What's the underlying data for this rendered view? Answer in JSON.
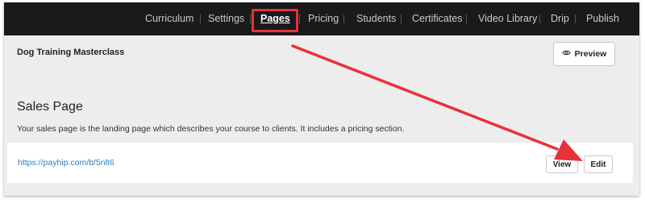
{
  "nav": {
    "items": [
      {
        "label": "Curriculum",
        "active": false
      },
      {
        "label": "Settings",
        "active": false
      },
      {
        "label": "Pages",
        "active": true
      },
      {
        "label": "Pricing",
        "active": false
      },
      {
        "label": "Students",
        "active": false
      },
      {
        "label": "Certificates",
        "active": false
      },
      {
        "label": "Video Library",
        "active": false
      },
      {
        "label": "Drip",
        "active": false
      },
      {
        "label": "Publish",
        "active": false
      }
    ]
  },
  "course": {
    "title": "Dog Training Masterclass",
    "preview_label": "Preview",
    "preview_icon": "eye-icon"
  },
  "sales_page": {
    "title": "Sales Page",
    "description": "Your sales page is the landing page which describes your course to clients. It includes a pricing section.",
    "url": "https://payhip.com/b/5nlt6",
    "view_label": "View",
    "edit_label": "Edit"
  },
  "annotation": {
    "color": "#e8313b",
    "highlight_target": "Pages",
    "arrow_target": "Edit"
  }
}
